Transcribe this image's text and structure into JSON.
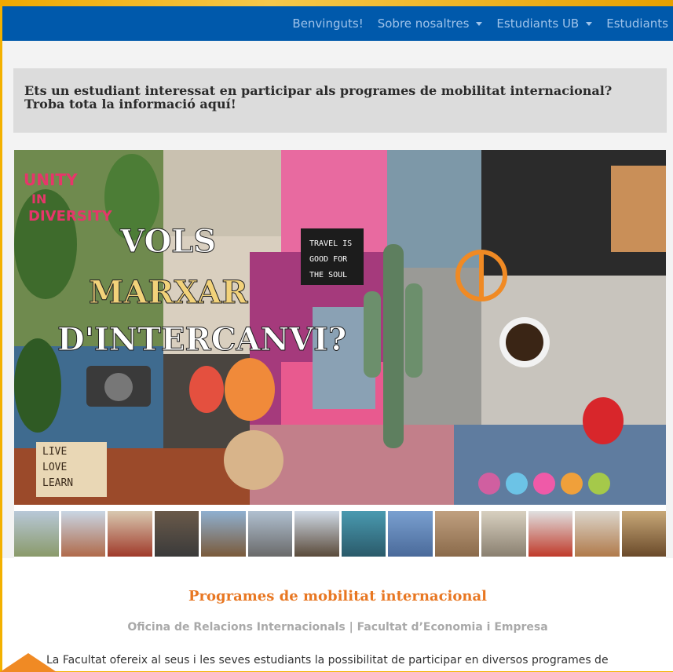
{
  "nav": {
    "items": [
      {
        "label": "Benvinguts!",
        "dropdown": false
      },
      {
        "label": "Sobre nosaltres",
        "dropdown": true
      },
      {
        "label": "Estudiants UB",
        "dropdown": true
      },
      {
        "label": "Estudiants",
        "dropdown": false
      }
    ]
  },
  "callout": {
    "text": "Ets un estudiant interessat en participar als programes de mobilitat internacional? Troba tota la informació aquí!"
  },
  "hero": {
    "collage_text": [
      "UNITY",
      "IN",
      "DIVERSITY",
      "VOLS",
      "MARXAR",
      "D'INTERCANVI?",
      "TRAVEL IS",
      "GOOD FOR",
      "THE SOUL",
      "LIVE",
      "LOVE",
      "LEARN"
    ]
  },
  "content": {
    "heading": "Programes de mobilitat internacional",
    "subheading": "Oficina de Relacions Internacionals | Facultat d’Economia i Empresa",
    "body": "La Facultat ofereix al seus i les seves estudiants la possibilitat de participar en diversos programes de"
  },
  "colors": {
    "navbar": "#0059ab",
    "accent": "#e87722",
    "frame": "#f3b100"
  }
}
